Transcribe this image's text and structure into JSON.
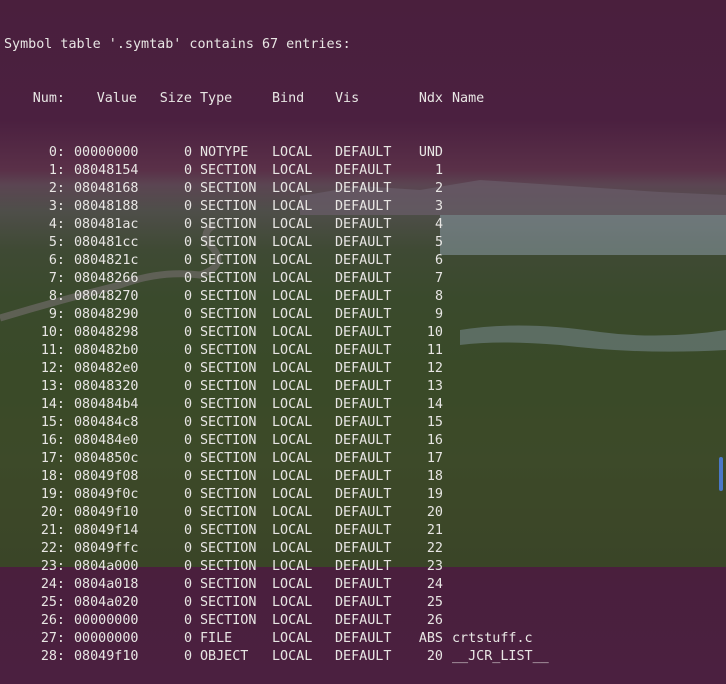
{
  "terminal": {
    "heading": "Symbol table '.symtab' contains 67 entries:",
    "columns": {
      "num": "Num:",
      "value": "Value",
      "size": "Size",
      "type": "Type",
      "bind": "Bind",
      "vis": "Vis",
      "ndx": "Ndx",
      "name": "Name"
    },
    "rows": [
      {
        "num": "0:",
        "value": "00000000",
        "size": "0",
        "type": "NOTYPE",
        "bind": "LOCAL",
        "vis": "DEFAULT",
        "ndx": "UND",
        "name": ""
      },
      {
        "num": "1:",
        "value": "08048154",
        "size": "0",
        "type": "SECTION",
        "bind": "LOCAL",
        "vis": "DEFAULT",
        "ndx": "1",
        "name": ""
      },
      {
        "num": "2:",
        "value": "08048168",
        "size": "0",
        "type": "SECTION",
        "bind": "LOCAL",
        "vis": "DEFAULT",
        "ndx": "2",
        "name": ""
      },
      {
        "num": "3:",
        "value": "08048188",
        "size": "0",
        "type": "SECTION",
        "bind": "LOCAL",
        "vis": "DEFAULT",
        "ndx": "3",
        "name": ""
      },
      {
        "num": "4:",
        "value": "080481ac",
        "size": "0",
        "type": "SECTION",
        "bind": "LOCAL",
        "vis": "DEFAULT",
        "ndx": "4",
        "name": ""
      },
      {
        "num": "5:",
        "value": "080481cc",
        "size": "0",
        "type": "SECTION",
        "bind": "LOCAL",
        "vis": "DEFAULT",
        "ndx": "5",
        "name": ""
      },
      {
        "num": "6:",
        "value": "0804821c",
        "size": "0",
        "type": "SECTION",
        "bind": "LOCAL",
        "vis": "DEFAULT",
        "ndx": "6",
        "name": ""
      },
      {
        "num": "7:",
        "value": "08048266",
        "size": "0",
        "type": "SECTION",
        "bind": "LOCAL",
        "vis": "DEFAULT",
        "ndx": "7",
        "name": ""
      },
      {
        "num": "8:",
        "value": "08048270",
        "size": "0",
        "type": "SECTION",
        "bind": "LOCAL",
        "vis": "DEFAULT",
        "ndx": "8",
        "name": ""
      },
      {
        "num": "9:",
        "value": "08048290",
        "size": "0",
        "type": "SECTION",
        "bind": "LOCAL",
        "vis": "DEFAULT",
        "ndx": "9",
        "name": ""
      },
      {
        "num": "10:",
        "value": "08048298",
        "size": "0",
        "type": "SECTION",
        "bind": "LOCAL",
        "vis": "DEFAULT",
        "ndx": "10",
        "name": ""
      },
      {
        "num": "11:",
        "value": "080482b0",
        "size": "0",
        "type": "SECTION",
        "bind": "LOCAL",
        "vis": "DEFAULT",
        "ndx": "11",
        "name": ""
      },
      {
        "num": "12:",
        "value": "080482e0",
        "size": "0",
        "type": "SECTION",
        "bind": "LOCAL",
        "vis": "DEFAULT",
        "ndx": "12",
        "name": ""
      },
      {
        "num": "13:",
        "value": "08048320",
        "size": "0",
        "type": "SECTION",
        "bind": "LOCAL",
        "vis": "DEFAULT",
        "ndx": "13",
        "name": ""
      },
      {
        "num": "14:",
        "value": "080484b4",
        "size": "0",
        "type": "SECTION",
        "bind": "LOCAL",
        "vis": "DEFAULT",
        "ndx": "14",
        "name": ""
      },
      {
        "num": "15:",
        "value": "080484c8",
        "size": "0",
        "type": "SECTION",
        "bind": "LOCAL",
        "vis": "DEFAULT",
        "ndx": "15",
        "name": ""
      },
      {
        "num": "16:",
        "value": "080484e0",
        "size": "0",
        "type": "SECTION",
        "bind": "LOCAL",
        "vis": "DEFAULT",
        "ndx": "16",
        "name": ""
      },
      {
        "num": "17:",
        "value": "0804850c",
        "size": "0",
        "type": "SECTION",
        "bind": "LOCAL",
        "vis": "DEFAULT",
        "ndx": "17",
        "name": ""
      },
      {
        "num": "18:",
        "value": "08049f08",
        "size": "0",
        "type": "SECTION",
        "bind": "LOCAL",
        "vis": "DEFAULT",
        "ndx": "18",
        "name": ""
      },
      {
        "num": "19:",
        "value": "08049f0c",
        "size": "0",
        "type": "SECTION",
        "bind": "LOCAL",
        "vis": "DEFAULT",
        "ndx": "19",
        "name": ""
      },
      {
        "num": "20:",
        "value": "08049f10",
        "size": "0",
        "type": "SECTION",
        "bind": "LOCAL",
        "vis": "DEFAULT",
        "ndx": "20",
        "name": ""
      },
      {
        "num": "21:",
        "value": "08049f14",
        "size": "0",
        "type": "SECTION",
        "bind": "LOCAL",
        "vis": "DEFAULT",
        "ndx": "21",
        "name": ""
      },
      {
        "num": "22:",
        "value": "08049ffc",
        "size": "0",
        "type": "SECTION",
        "bind": "LOCAL",
        "vis": "DEFAULT",
        "ndx": "22",
        "name": ""
      },
      {
        "num": "23:",
        "value": "0804a000",
        "size": "0",
        "type": "SECTION",
        "bind": "LOCAL",
        "vis": "DEFAULT",
        "ndx": "23",
        "name": ""
      },
      {
        "num": "24:",
        "value": "0804a018",
        "size": "0",
        "type": "SECTION",
        "bind": "LOCAL",
        "vis": "DEFAULT",
        "ndx": "24",
        "name": ""
      },
      {
        "num": "25:",
        "value": "0804a020",
        "size": "0",
        "type": "SECTION",
        "bind": "LOCAL",
        "vis": "DEFAULT",
        "ndx": "25",
        "name": ""
      },
      {
        "num": "26:",
        "value": "00000000",
        "size": "0",
        "type": "SECTION",
        "bind": "LOCAL",
        "vis": "DEFAULT",
        "ndx": "26",
        "name": ""
      },
      {
        "num": "27:",
        "value": "00000000",
        "size": "0",
        "type": "FILE",
        "bind": "LOCAL",
        "vis": "DEFAULT",
        "ndx": "ABS",
        "name": "crtstuff.c"
      },
      {
        "num": "28:",
        "value": "08049f10",
        "size": "0",
        "type": "OBJECT",
        "bind": "LOCAL",
        "vis": "DEFAULT",
        "ndx": "20",
        "name": "__JCR_LIST__"
      }
    ]
  },
  "colors": {
    "text": "#e8e6e4",
    "scrollbar": "#4a78c8"
  }
}
